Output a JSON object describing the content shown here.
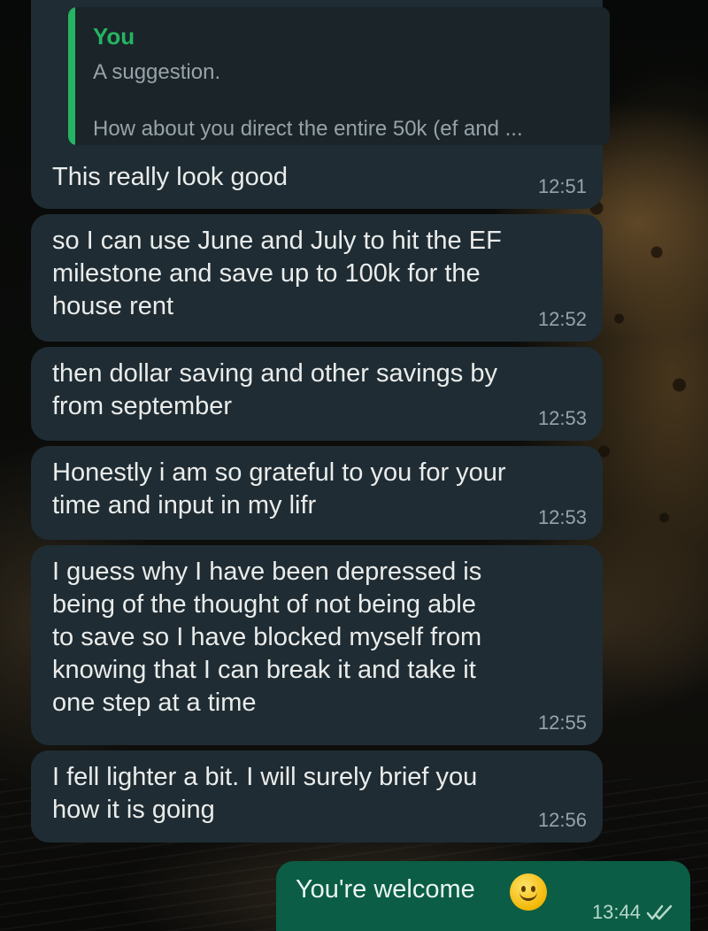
{
  "quoted": {
    "author": "You",
    "line1": "A suggestion.",
    "line2": "How about you direct the entire 50k (ef and ..."
  },
  "messages": [
    {
      "text": "This really look good",
      "time": "12:51"
    },
    {
      "text": "so I can use June and July to hit the EF\nmilestone and save up to 100k for the\nhouse rent",
      "time": "12:52"
    },
    {
      "text": "then dollar saving and other savings by\nfrom september",
      "time": "12:53"
    },
    {
      "text": "Honestly i am so grateful to you for your\ntime and input in my lifr",
      "time": "12:53"
    },
    {
      "text": "I guess why I have been depressed is\nbeing of the thought of not being able\nto save so I have blocked myself from\nknowing that I can break it and take it\none step at a time",
      "time": "12:55"
    },
    {
      "text": "I fell lighter a bit. I will surely brief you\nhow it is going",
      "time": "12:56"
    }
  ],
  "outgoing": {
    "text": "You're welcome",
    "emoji": "smiling-face-icon",
    "time": "13:44",
    "status": "read"
  },
  "colors": {
    "incoming_bubble": "#1f2c33",
    "outgoing_bubble": "#0b5d45",
    "quote_accent": "#25b562",
    "read_ticks": "#b7d8cc"
  }
}
